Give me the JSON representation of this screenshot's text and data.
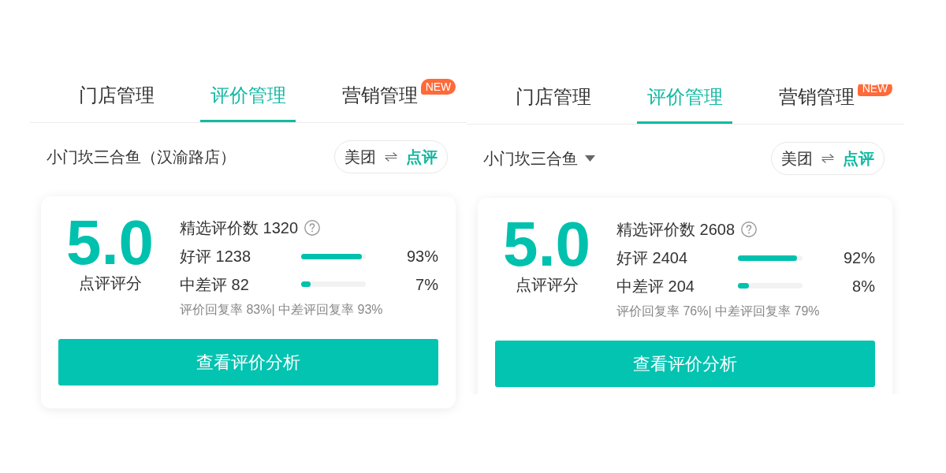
{
  "panels": [
    {
      "tabs": [
        {
          "label": "门店管理",
          "selected": false
        },
        {
          "label": "评价管理",
          "selected": true
        },
        {
          "label": "营销管理",
          "selected": false,
          "badge": "NEW"
        }
      ],
      "store": {
        "name": "小门坎三合鱼（汉渝路店）",
        "dropdown": false
      },
      "platform_switch": [
        {
          "label": "美团",
          "selected": false
        },
        {
          "label": "点评",
          "selected": true
        }
      ],
      "score": {
        "value": "5.0",
        "label": "点评评分"
      },
      "selected_reviews": "精选评价数 1320",
      "breakdown": [
        {
          "label": "好评 1238",
          "level": 0.94,
          "percent": "93%"
        },
        {
          "label": "中差评 82",
          "level": 0.15,
          "percent": "7%"
        }
      ],
      "reply_rates": "评价回复率 83%| 中差评回复率 93%",
      "action_button": "查看评价分析"
    },
    {
      "tabs": [
        {
          "label": "门店管理",
          "selected": false
        },
        {
          "label": "评价管理",
          "selected": true
        },
        {
          "label": "营销管理",
          "selected": false,
          "badge": "NEW"
        }
      ],
      "store": {
        "name": "小门坎三合鱼",
        "dropdown": true
      },
      "platform_switch": [
        {
          "label": "美团",
          "selected": false
        },
        {
          "label": "点评",
          "selected": true
        }
      ],
      "score": {
        "value": "5.0",
        "label": "点评评分"
      },
      "selected_reviews": "精选评价数 2608",
      "breakdown": [
        {
          "label": "好评 2404",
          "level": 0.91,
          "percent": "92%"
        },
        {
          "label": "中差评 204",
          "level": 0.17,
          "percent": "8%"
        }
      ],
      "reply_rates": "评价回复率 76%| 中差评回复率 79%",
      "action_button": "查看评价分析"
    }
  ]
}
